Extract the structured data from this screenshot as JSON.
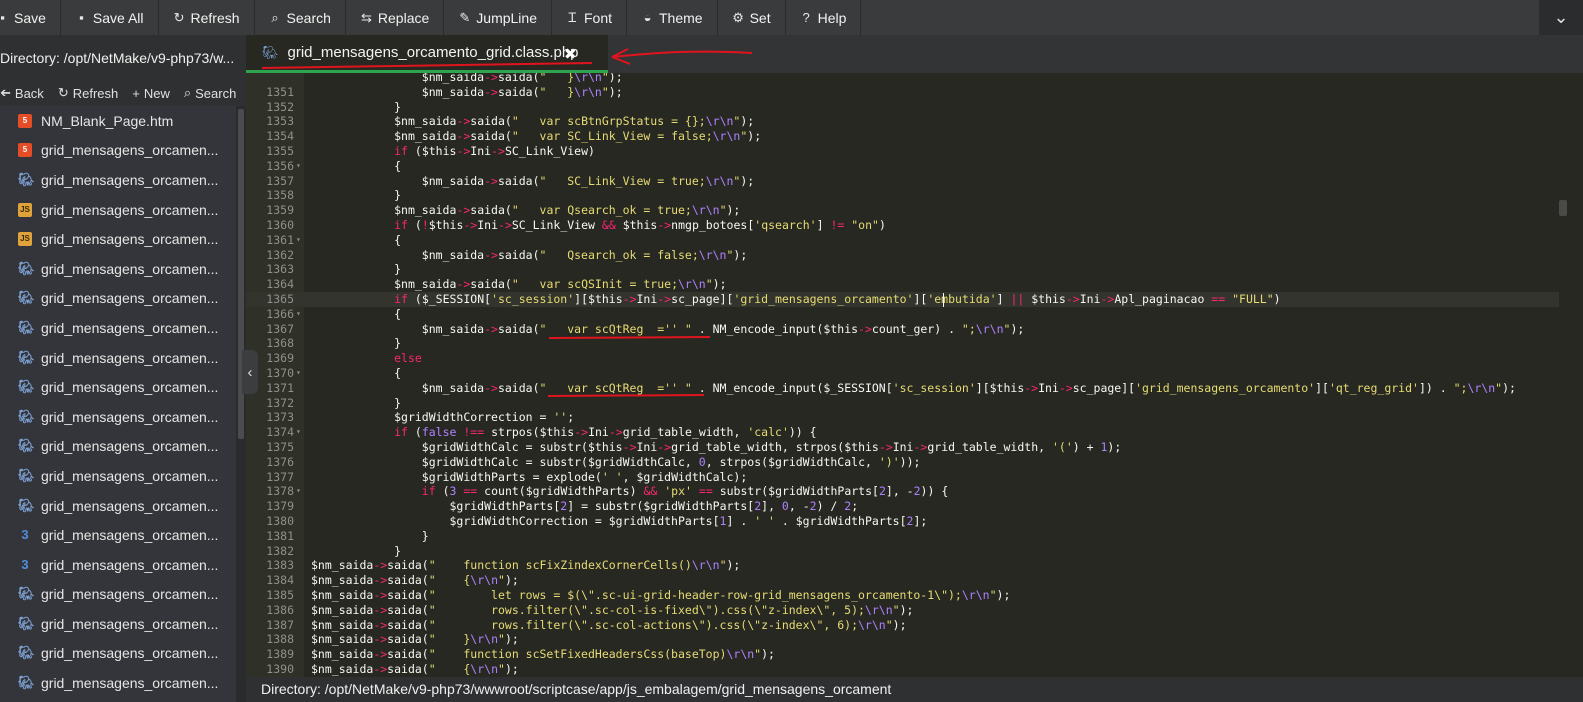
{
  "toolbar": {
    "buttons": [
      {
        "label": "Save",
        "icon": "floppy-icon",
        "glyph": "▪"
      },
      {
        "label": "Save All",
        "icon": "floppy-multi-icon",
        "glyph": "▪"
      },
      {
        "label": "Refresh",
        "icon": "refresh-icon",
        "glyph": "↻"
      },
      {
        "label": "Search",
        "icon": "search-icon",
        "glyph": "⌕"
      },
      {
        "label": "Replace",
        "icon": "replace-icon",
        "glyph": "⇆"
      },
      {
        "label": "JumpLine",
        "icon": "pin-icon",
        "glyph": "✎"
      },
      {
        "label": "Font",
        "icon": "font-icon",
        "glyph": "Ꮖ"
      },
      {
        "label": "Theme",
        "icon": "theme-icon",
        "glyph": "◒"
      },
      {
        "label": "Set",
        "icon": "gear-icon",
        "glyph": "⚙"
      },
      {
        "label": "Help",
        "icon": "help-icon",
        "glyph": "?"
      }
    ],
    "collapse_glyph": "⌄"
  },
  "sidebar": {
    "directory": "Directory: /opt/NetMake/v9-php73/w...",
    "actions": [
      {
        "label": "Back",
        "icon": "arrow-left-icon",
        "glyph": "➔"
      },
      {
        "label": "Refresh",
        "icon": "refresh-icon",
        "glyph": "↻"
      },
      {
        "label": "New",
        "icon": "plus-icon",
        "glyph": "+"
      },
      {
        "label": "Search",
        "icon": "search-icon",
        "glyph": "⌕"
      }
    ],
    "files": [
      {
        "name": "NM_Blank_Page.htm",
        "type": "html"
      },
      {
        "name": "grid_mensagens_orcamen...",
        "type": "html"
      },
      {
        "name": "grid_mensagens_orcamen...",
        "type": "php"
      },
      {
        "name": "grid_mensagens_orcamen...",
        "type": "js"
      },
      {
        "name": "grid_mensagens_orcamen...",
        "type": "js"
      },
      {
        "name": "grid_mensagens_orcamen...",
        "type": "php"
      },
      {
        "name": "grid_mensagens_orcamen...",
        "type": "php"
      },
      {
        "name": "grid_mensagens_orcamen...",
        "type": "php"
      },
      {
        "name": "grid_mensagens_orcamen...",
        "type": "php"
      },
      {
        "name": "grid_mensagens_orcamen...",
        "type": "php"
      },
      {
        "name": "grid_mensagens_orcamen...",
        "type": "php"
      },
      {
        "name": "grid_mensagens_orcamen...",
        "type": "php"
      },
      {
        "name": "grid_mensagens_orcamen...",
        "type": "php"
      },
      {
        "name": "grid_mensagens_orcamen...",
        "type": "php"
      },
      {
        "name": "grid_mensagens_orcamen...",
        "type": "css"
      },
      {
        "name": "grid_mensagens_orcamen...",
        "type": "css"
      },
      {
        "name": "grid_mensagens_orcamen...",
        "type": "php"
      },
      {
        "name": "grid_mensagens_orcamen...",
        "type": "php"
      },
      {
        "name": "grid_mensagens_orcamen...",
        "type": "php"
      },
      {
        "name": "grid_mensagens_orcamen...",
        "type": "php"
      }
    ],
    "toggle_glyph": "‹"
  },
  "tab": {
    "title": "grid_mensagens_orcamento_grid.class.php",
    "icon": "php-elephant-icon",
    "close_glyph": "✖"
  },
  "editor": {
    "first_line": 1350,
    "active_line": 1365,
    "lines": [
      {
        "n": "",
        "fold": "",
        "text": "                $nm_saida->saida(\"   }\\r\\n\");"
      },
      {
        "n": "1351",
        "fold": "",
        "text": "                $nm_saida->saida(\"   }\\r\\n\");"
      },
      {
        "n": "1352",
        "fold": "",
        "text": "            }"
      },
      {
        "n": "1353",
        "fold": "",
        "text": "            $nm_saida->saida(\"   var scBtnGrpStatus = {};\\r\\n\");"
      },
      {
        "n": "1354",
        "fold": "",
        "text": "            $nm_saida->saida(\"   var SC_Link_View = false;\\r\\n\");"
      },
      {
        "n": "1355",
        "fold": "",
        "text": "            if ($this->Ini->SC_Link_View)"
      },
      {
        "n": "1356",
        "fold": "▾",
        "text": "            {"
      },
      {
        "n": "1357",
        "fold": "",
        "text": "                $nm_saida->saida(\"   SC_Link_View = true;\\r\\n\");"
      },
      {
        "n": "1358",
        "fold": "",
        "text": "            }"
      },
      {
        "n": "1359",
        "fold": "",
        "text": "            $nm_saida->saida(\"   var Qsearch_ok = true;\\r\\n\");"
      },
      {
        "n": "1360",
        "fold": "",
        "text": "            if (!$this->Ini->SC_Link_View && $this->nmgp_botoes['qsearch'] != \"on\")"
      },
      {
        "n": "1361",
        "fold": "▾",
        "text": "            {"
      },
      {
        "n": "1362",
        "fold": "",
        "text": "                $nm_saida->saida(\"   Qsearch_ok = false;\\r\\n\");"
      },
      {
        "n": "1363",
        "fold": "",
        "text": "            }"
      },
      {
        "n": "1364",
        "fold": "",
        "text": "            $nm_saida->saida(\"   var scQSInit = true;\\r\\n\");"
      },
      {
        "n": "1365",
        "fold": "",
        "text": "            if ($_SESSION['sc_session'][$this->Ini->sc_page]['grid_mensagens_orcamento']['embutida'] || $this->Ini->Apl_paginacao == \"FULL\")"
      },
      {
        "n": "1366",
        "fold": "▾",
        "text": "            {"
      },
      {
        "n": "1367",
        "fold": "",
        "text": "                $nm_saida->saida(\"   var scQtReg  ='' \" . NM_encode_input($this->count_ger) . \";\\r\\n\");"
      },
      {
        "n": "1368",
        "fold": "",
        "text": "            }"
      },
      {
        "n": "1369",
        "fold": "",
        "text": "            else"
      },
      {
        "n": "1370",
        "fold": "▾",
        "text": "            {"
      },
      {
        "n": "1371",
        "fold": "",
        "text": "                $nm_saida->saida(\"   var scQtReg  ='' \" . NM_encode_input($_SESSION['sc_session'][$this->Ini->sc_page]['grid_mensagens_orcamento']['qt_reg_grid']) . \";\\r\\n\");"
      },
      {
        "n": "1372",
        "fold": "",
        "text": "            }"
      },
      {
        "n": "1373",
        "fold": "",
        "text": "            $gridWidthCorrection = '';"
      },
      {
        "n": "1374",
        "fold": "▾",
        "text": "            if (false !== strpos($this->Ini->grid_table_width, 'calc')) {"
      },
      {
        "n": "1375",
        "fold": "",
        "text": "                $gridWidthCalc = substr($this->Ini->grid_table_width, strpos($this->Ini->grid_table_width, '(') + 1);"
      },
      {
        "n": "1376",
        "fold": "",
        "text": "                $gridWidthCalc = substr($gridWidthCalc, 0, strpos($gridWidthCalc, ')'));"
      },
      {
        "n": "1377",
        "fold": "",
        "text": "                $gridWidthParts = explode(' ', $gridWidthCalc);"
      },
      {
        "n": "1378",
        "fold": "▾",
        "text": "                if (3 == count($gridWidthParts) && 'px' == substr($gridWidthParts[2], -2)) {"
      },
      {
        "n": "1379",
        "fold": "",
        "text": "                    $gridWidthParts[2] = substr($gridWidthParts[2], 0, -2) / 2;"
      },
      {
        "n": "1380",
        "fold": "",
        "text": "                    $gridWidthCorrection = $gridWidthParts[1] . ' ' . $gridWidthParts[2];"
      },
      {
        "n": "1381",
        "fold": "",
        "text": "                }"
      },
      {
        "n": "1382",
        "fold": "",
        "text": "            }"
      },
      {
        "n": "1383",
        "fold": "",
        "text": "$nm_saida->saida(\"    function scFixZindexCornerCells()\\r\\n\");"
      },
      {
        "n": "1384",
        "fold": "",
        "text": "$nm_saida->saida(\"    {\\r\\n\");"
      },
      {
        "n": "1385",
        "fold": "",
        "text": "$nm_saida->saida(\"        let rows = $(\\\".sc-ui-grid-header-row-grid_mensagens_orcamento-1\\\");\\r\\n\");"
      },
      {
        "n": "1386",
        "fold": "",
        "text": "$nm_saida->saida(\"        rows.filter(\\\".sc-col-is-fixed\\\").css(\\\"z-index\\\", 5);\\r\\n\");"
      },
      {
        "n": "1387",
        "fold": "",
        "text": "$nm_saida->saida(\"        rows.filter(\\\".sc-col-actions\\\").css(\\\"z-index\\\", 6);\\r\\n\");"
      },
      {
        "n": "1388",
        "fold": "",
        "text": "$nm_saida->saida(\"    }\\r\\n\");"
      },
      {
        "n": "1389",
        "fold": "",
        "text": "$nm_saida->saida(\"    function scSetFixedHeadersCss(baseTop)\\r\\n\");"
      },
      {
        "n": "1390",
        "fold": "",
        "text": "$nm_saida->saida(\"    {\\r\\n\");"
      }
    ]
  },
  "status": {
    "path": "Directory: /opt/NetMake/v9-php73/wwwroot/scriptcase/app/js_embalagem/grid_mensagens_orcament"
  },
  "colors": {
    "annotation": "#e0141e",
    "tab_active_border": "#2ea44f",
    "editor_bg": "#272822"
  }
}
